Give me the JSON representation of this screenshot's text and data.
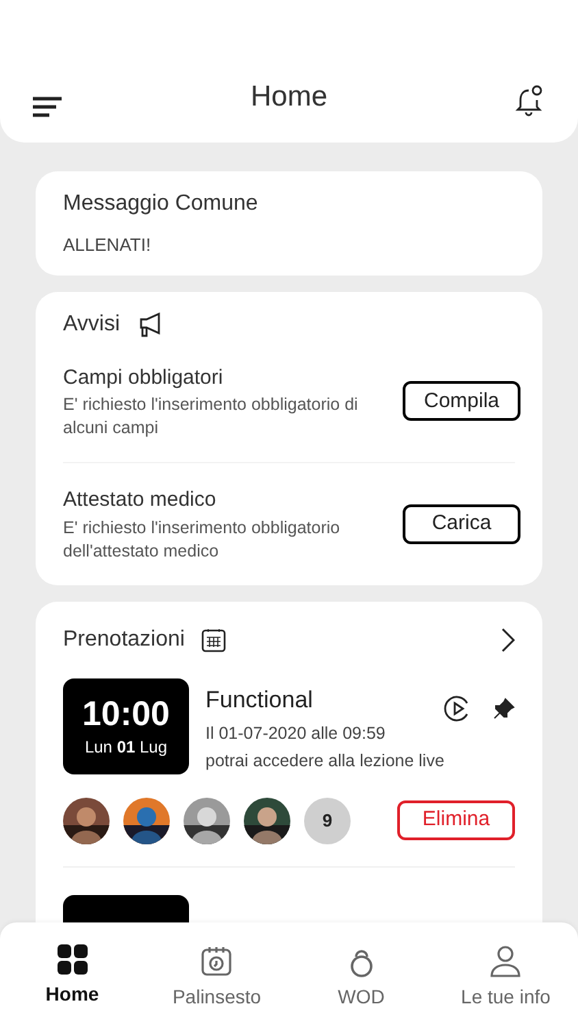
{
  "header": {
    "title": "Home"
  },
  "message_card": {
    "title": "Messaggio Comune",
    "text": "ALLENATI!"
  },
  "notices": {
    "title": "Avvisi",
    "items": [
      {
        "title": "Campi obbligatori",
        "text": "E' richiesto l'inserimento obbligatorio di alcuni campi",
        "action": "Compila"
      },
      {
        "title": "Attestato medico",
        "text": "E' richiesto l'inserimento obbligatorio dell'attestato medico",
        "action": "Carica"
      }
    ]
  },
  "bookings": {
    "title": "Prenotazioni",
    "items": [
      {
        "time": "10:00",
        "date": "Lun **01** Lug",
        "name": "Functional",
        "line_1": "Il 01-07-2020 alle 09:59",
        "line_2": "potrai accedere alla lezione live",
        "extra_count": "9",
        "action": "Elimina"
      }
    ]
  },
  "nav": [
    {
      "label": "Home",
      "selected": true,
      "kind": "grid"
    },
    {
      "label": "Palinsesto",
      "selected": false,
      "kind": "calendar"
    },
    {
      "label": "WOD",
      "selected": false,
      "kind": "kettlebell"
    },
    {
      "label": "Le tue info",
      "selected": false,
      "kind": "user"
    }
  ]
}
